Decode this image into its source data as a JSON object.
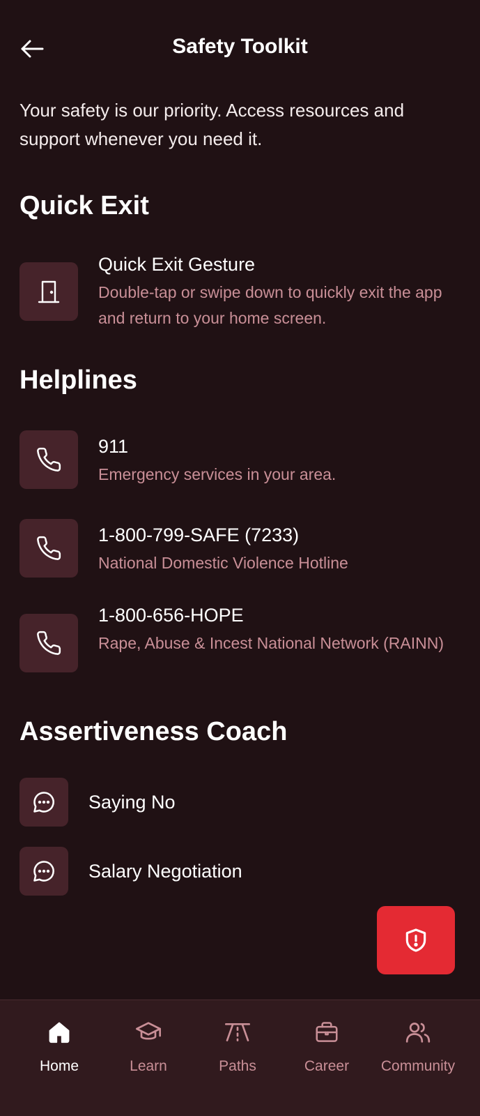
{
  "header": {
    "title": "Safety Toolkit"
  },
  "intro": "Your safety is our priority. Access resources and support whenever you need it.",
  "quick_exit": {
    "heading": "Quick Exit",
    "item": {
      "title": "Quick Exit Gesture",
      "description": "Double-tap or swipe down to quickly exit the app and return to your home screen.",
      "icon": "door-icon"
    }
  },
  "helplines": {
    "heading": "Helplines",
    "items": [
      {
        "number": "911",
        "description": "Emergency services in your area.",
        "icon": "phone-icon"
      },
      {
        "number": "1-800-799-SAFE (7233)",
        "description": "National Domestic Violence Hotline",
        "icon": "phone-icon"
      },
      {
        "number": "1-800-656-HOPE",
        "description": "Rape, Abuse & Incest National Network (RAINN)",
        "icon": "phone-icon"
      }
    ]
  },
  "assertiveness": {
    "heading": "Assertiveness Coach",
    "items": [
      {
        "label": "Saying No",
        "icon": "chat-bubble-icon"
      },
      {
        "label": "Salary Negotiation",
        "icon": "chat-bubble-icon"
      }
    ]
  },
  "sos_button": {
    "icon": "shield-alert-icon",
    "color": "#e42a33"
  },
  "bottom_nav": {
    "items": [
      {
        "label": "Home",
        "icon": "home-icon",
        "active": true
      },
      {
        "label": "Learn",
        "icon": "graduation-cap-icon",
        "active": false
      },
      {
        "label": "Paths",
        "icon": "road-icon",
        "active": false
      },
      {
        "label": "Career",
        "icon": "briefcase-icon",
        "active": false
      },
      {
        "label": "Community",
        "icon": "users-icon",
        "active": false
      }
    ]
  },
  "colors": {
    "background": "#201114",
    "card": "#46232a",
    "muted_text": "#c98f97",
    "nav_background": "#311a1e",
    "accent_red": "#e42a33"
  }
}
